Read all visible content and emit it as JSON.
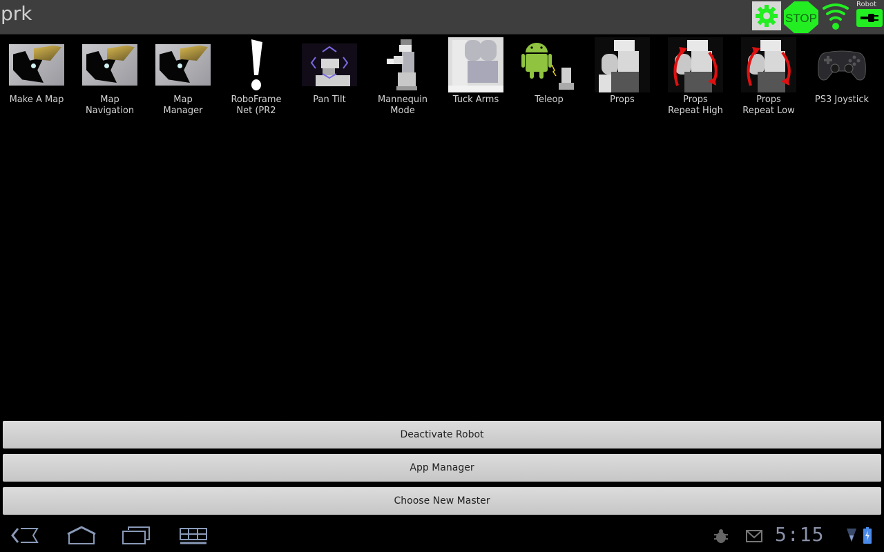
{
  "titlebar": {
    "title": "prk",
    "robot_label": "Robot",
    "stop_label": "STOP",
    "accent_color": "#22ee22"
  },
  "apps": [
    {
      "label": "Make A Map",
      "icon": "map-icon"
    },
    {
      "label": "Map\nNavigation",
      "icon": "map-icon"
    },
    {
      "label": "Map\nManager",
      "icon": "map-icon"
    },
    {
      "label": "RoboFrame\nNet (PR2",
      "icon": "exclamation-icon"
    },
    {
      "label": "Pan Tilt",
      "icon": "pan-tilt-robot-icon"
    },
    {
      "label": "Mannequin\nMode",
      "icon": "mannequin-robot-icon"
    },
    {
      "label": "Tuck Arms",
      "icon": "tuck-arms-robot-icon"
    },
    {
      "label": "Teleop",
      "icon": "android-teleop-icon"
    },
    {
      "label": "Props",
      "icon": "props-robot-icon"
    },
    {
      "label": "Props\nRepeat High",
      "icon": "props-repeat-icon"
    },
    {
      "label": "Props\nRepeat Low",
      "icon": "props-repeat-icon"
    },
    {
      "label": "PS3 Joystick",
      "icon": "gamepad-icon"
    }
  ],
  "buttons": {
    "deactivate": "Deactivate Robot",
    "app_manager": "App Manager",
    "choose_master": "Choose New Master"
  },
  "statusbar": {
    "time": "5:15"
  }
}
